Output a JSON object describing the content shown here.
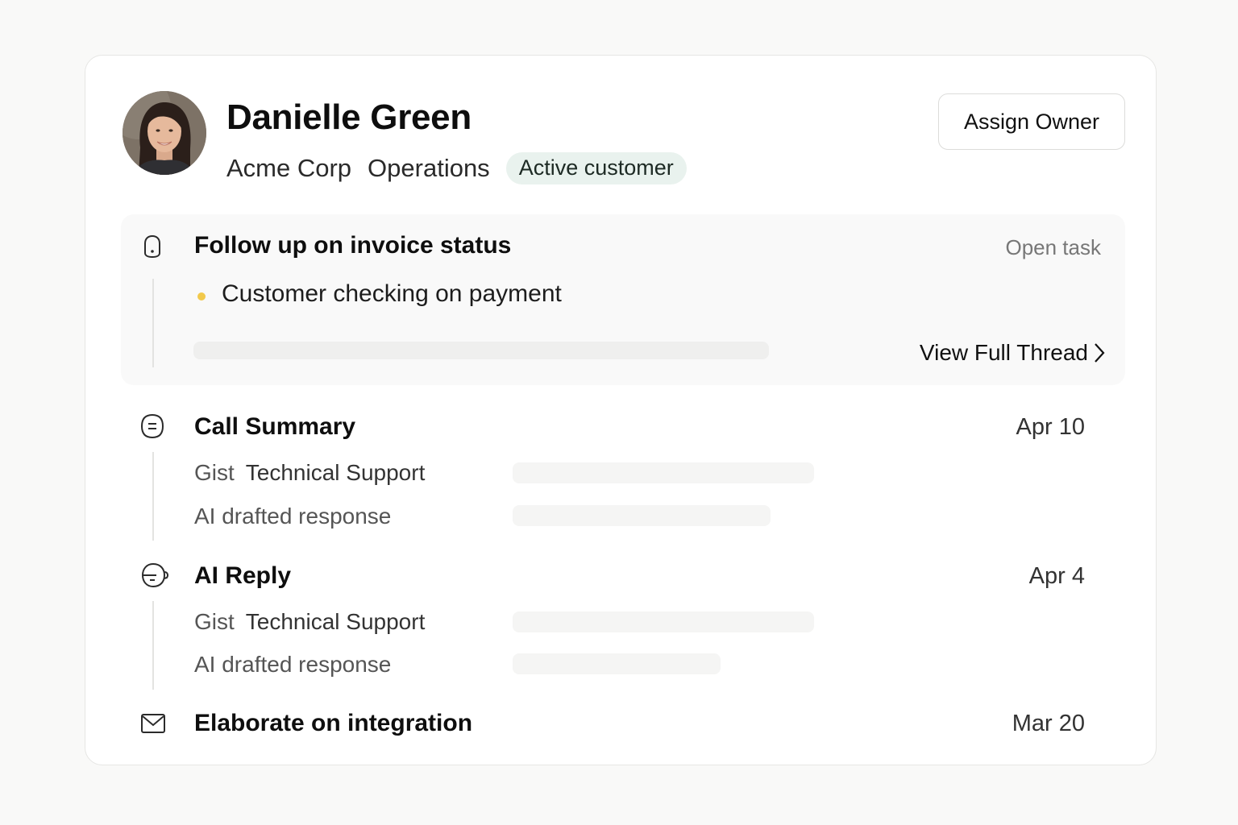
{
  "contact": {
    "name": "Danielle Green",
    "company": "Acme Corp",
    "department": "Operations",
    "status_badge": "Active customer"
  },
  "actions": {
    "assign_owner_label": "Assign Owner"
  },
  "task": {
    "title": "Follow up on invoice status",
    "status": "Open task",
    "note": "Customer checking on payment",
    "view_thread_label": "View Full Thread",
    "icon": "bell-icon"
  },
  "activities": [
    {
      "title": "Call Summary",
      "date": "Apr 10",
      "icon": "summary-icon",
      "gist_label": "Gist",
      "gist_value": "Technical Support",
      "drafted_label": "AI drafted response"
    },
    {
      "title": "AI Reply",
      "date": "Apr 4",
      "icon": "ai-reply-icon",
      "gist_label": "Gist",
      "gist_value": "Technical Support",
      "drafted_label": "AI drafted response"
    },
    {
      "title": "Elaborate on integration",
      "date": "Mar 20",
      "icon": "mail-icon"
    }
  ],
  "colors": {
    "badge_bg": "#e9f2ee",
    "bullet": "#f2c94c",
    "border": "#e6e6e4"
  }
}
